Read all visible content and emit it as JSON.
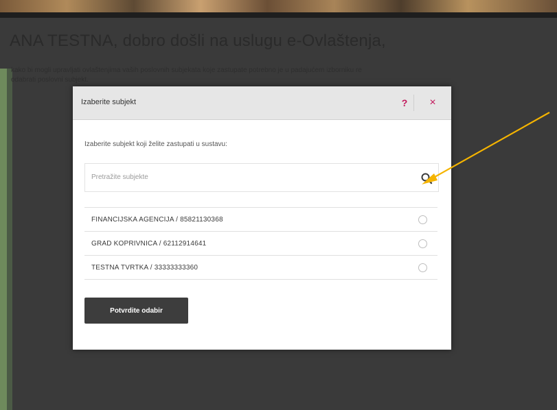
{
  "page": {
    "welcome_title": "ANA TESTNA, dobro došli na uslugu e-Ovlaštenja,",
    "intro_text_line1": "kako bi mogli upravljati ovlaštenjima vaših poslovnih subjekata koje zastupate potrebno je u padajućem izborniku re",
    "intro_text_line2": "odabrati poslovni subjekt."
  },
  "modal": {
    "title": "Izaberite subjekt",
    "help_label": "?",
    "close_label": "×",
    "instruction": "Izaberite subjekt koji želite zastupati u sustavu:",
    "search": {
      "placeholder": "Pretražite subjekte",
      "value": ""
    },
    "subjects": [
      {
        "label": "FINANCIJSKA AGENCIJA / 85821130368"
      },
      {
        "label": "GRAD KOPRIVNICA / 62112914641"
      },
      {
        "label": "TESTNA TVRTKA / 33333333360"
      }
    ],
    "confirm_label": "Potvrdite odabir"
  },
  "colors": {
    "accent": "#c2185b",
    "overlay": "#3a3a3a",
    "button_bg": "#3d3d3d",
    "annotation_arrow": "#f5b400"
  },
  "icons": {
    "search": "search-icon",
    "help": "question-icon",
    "close": "close-icon",
    "arrow": "annotation-arrow"
  }
}
